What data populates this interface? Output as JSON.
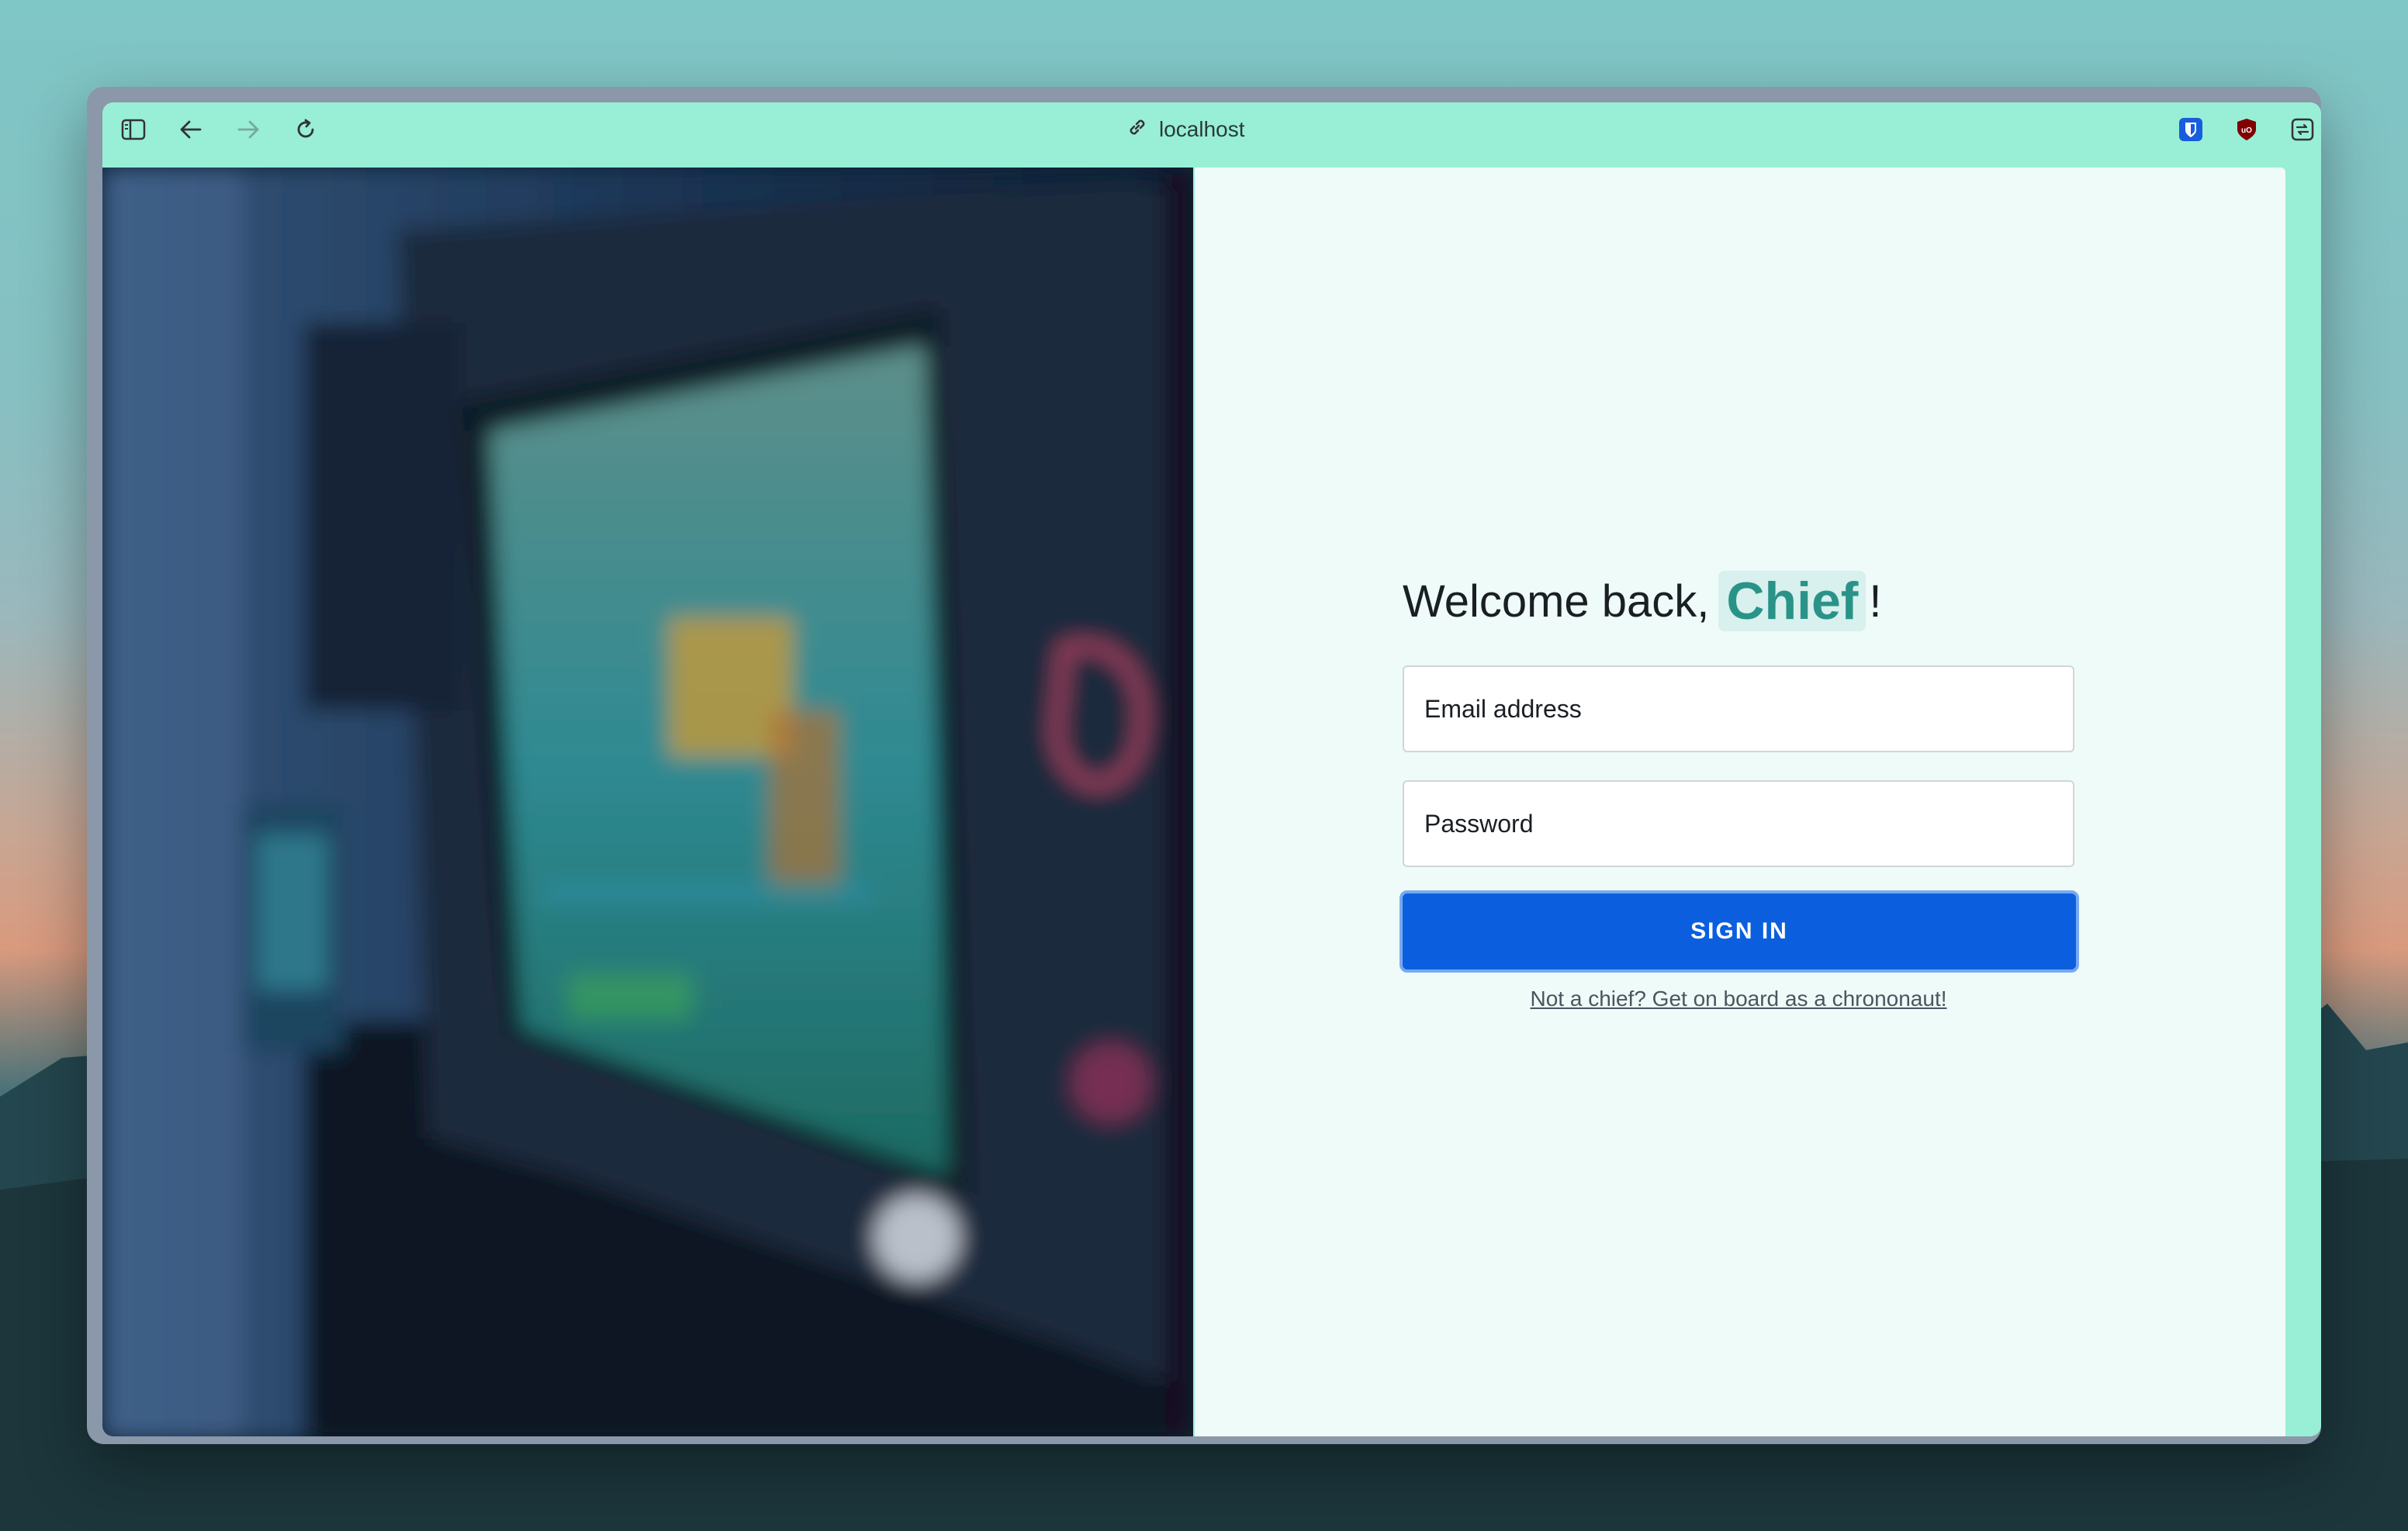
{
  "browser": {
    "url": "localhost",
    "icons": [
      "sidebar-toggle-icon",
      "back-arrow-icon",
      "forward-arrow-icon",
      "reload-icon",
      "link-icon",
      "bitwarden-shield-icon",
      "ublock-origin-icon",
      "extension-icon",
      "split-view-icon"
    ]
  },
  "login": {
    "greeting": "Welcome back,",
    "name": "Chief",
    "exclamation": "!",
    "email_placeholder": "Email address",
    "password_placeholder": "Password",
    "signin_label": "SIGN IN",
    "signup_link": "Not a chief? Get on board as a chrononaut!"
  },
  "colors": {
    "toolbar": "#98efd6",
    "panel": "#effbf8",
    "accent": "#2a9388",
    "button": "#0b5fde"
  }
}
